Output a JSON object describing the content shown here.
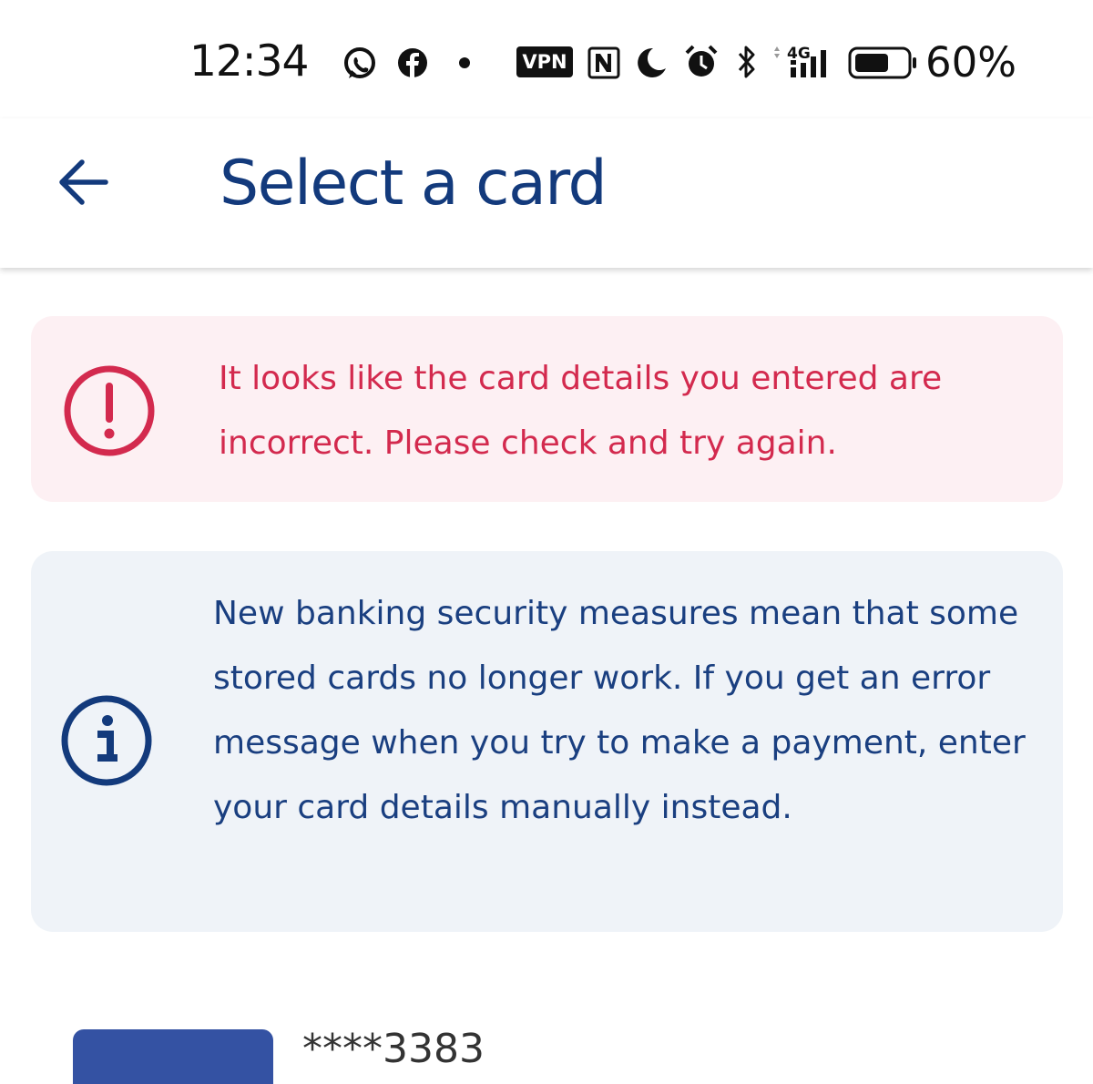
{
  "status_bar": {
    "time": "12:34",
    "vpn_label": "VPN",
    "network_label": "4G",
    "battery_percent": "60%",
    "battery_level": 0.6,
    "icons": [
      "whatsapp-icon",
      "facebook-icon",
      "notification-dot-icon",
      "vpn-icon",
      "nfc-icon",
      "do-not-disturb-moon-icon",
      "alarm-icon",
      "bluetooth-icon",
      "signal-4g-icon",
      "battery-icon"
    ]
  },
  "header": {
    "back_icon": "arrow-left-icon",
    "title": "Select a card"
  },
  "error_alert": {
    "icon": "exclamation-circle-icon",
    "message": "It looks like the card details you entered are incorrect. Please check and try again.",
    "color": "#d32a4e"
  },
  "info_alert": {
    "icon": "info-circle-icon",
    "message": "New banking security measures mean that some stored cards no longer work. If you get an error message when you try to make a payment, enter your card details manually instead.",
    "color": "#1a3f80"
  },
  "stored_card": {
    "number_masked": "****3383"
  },
  "colors": {
    "brand_blue": "#133a7c",
    "error_red": "#d32a4e",
    "card_blue": "#3452a3"
  }
}
